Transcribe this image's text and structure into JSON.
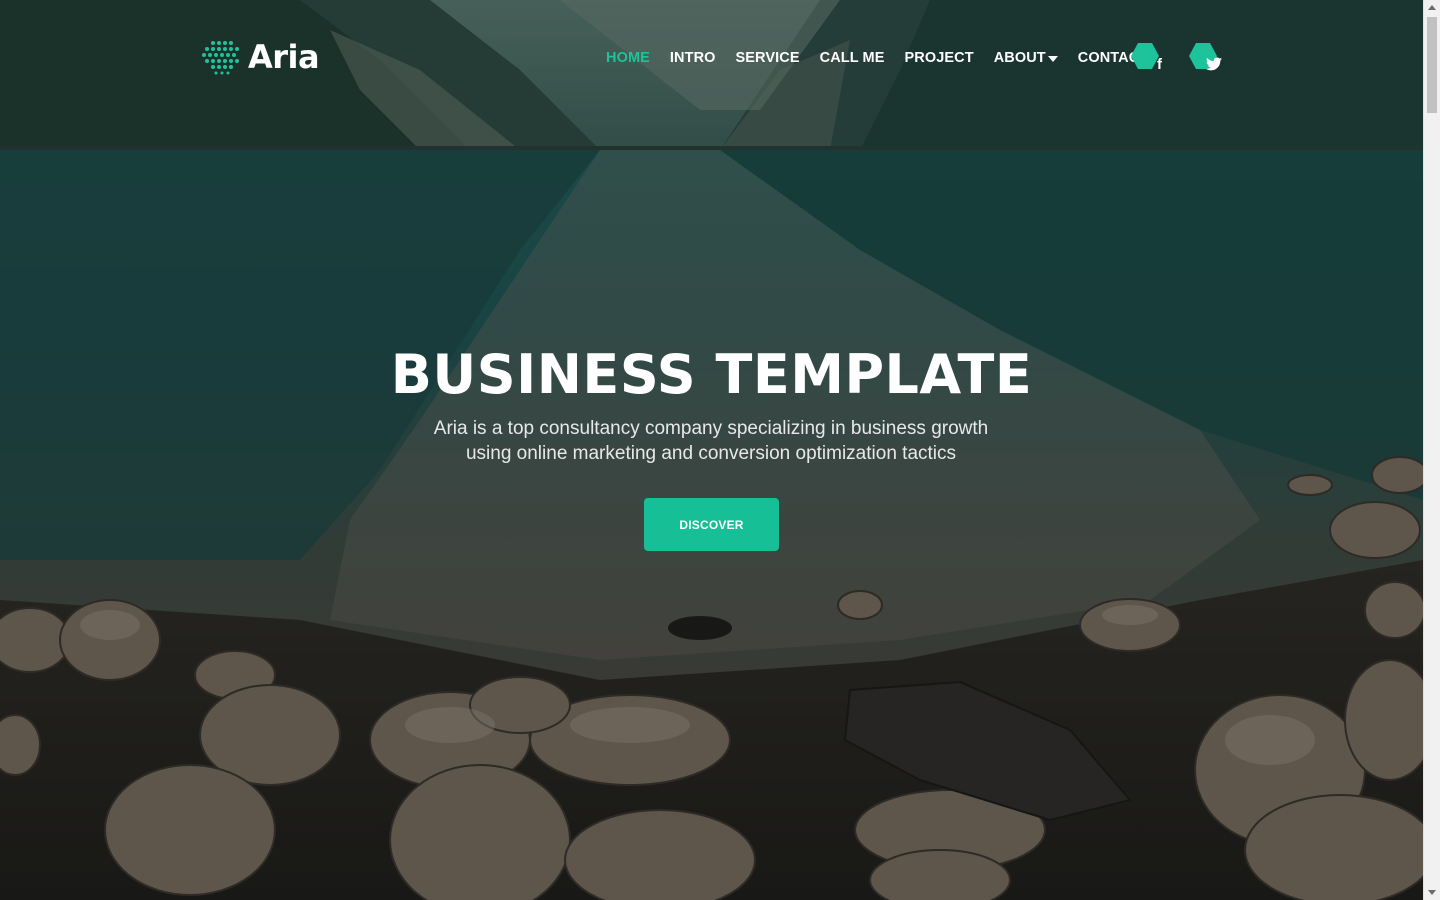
{
  "brand": {
    "name": "Aria",
    "accent_color": "#1ec39b",
    "logo_icon": "dot-cluster-logo-icon"
  },
  "nav": {
    "items": [
      {
        "label": "HOME",
        "active": true
      },
      {
        "label": "INTRO",
        "active": false
      },
      {
        "label": "SERVICE",
        "active": false
      },
      {
        "label": "CALL ME",
        "active": false
      },
      {
        "label": "PROJECT",
        "active": false
      },
      {
        "label": "ABOUT",
        "active": false,
        "dropdown": true,
        "icon": "caret-down-icon"
      },
      {
        "label": "CONTACT",
        "active": false
      }
    ],
    "social": [
      {
        "name": "facebook",
        "icon": "facebook-icon",
        "glyph": "f"
      },
      {
        "name": "twitter",
        "icon": "twitter-icon",
        "glyph": "🐦"
      }
    ]
  },
  "hero": {
    "title": "BUSINESS TEMPLATE",
    "subtitle": "Aria is a top consultancy company specializing in business growth using online marketing and conversion optimization tactics",
    "cta_label": "DISCOVER",
    "cta_color": "#16bf95"
  }
}
